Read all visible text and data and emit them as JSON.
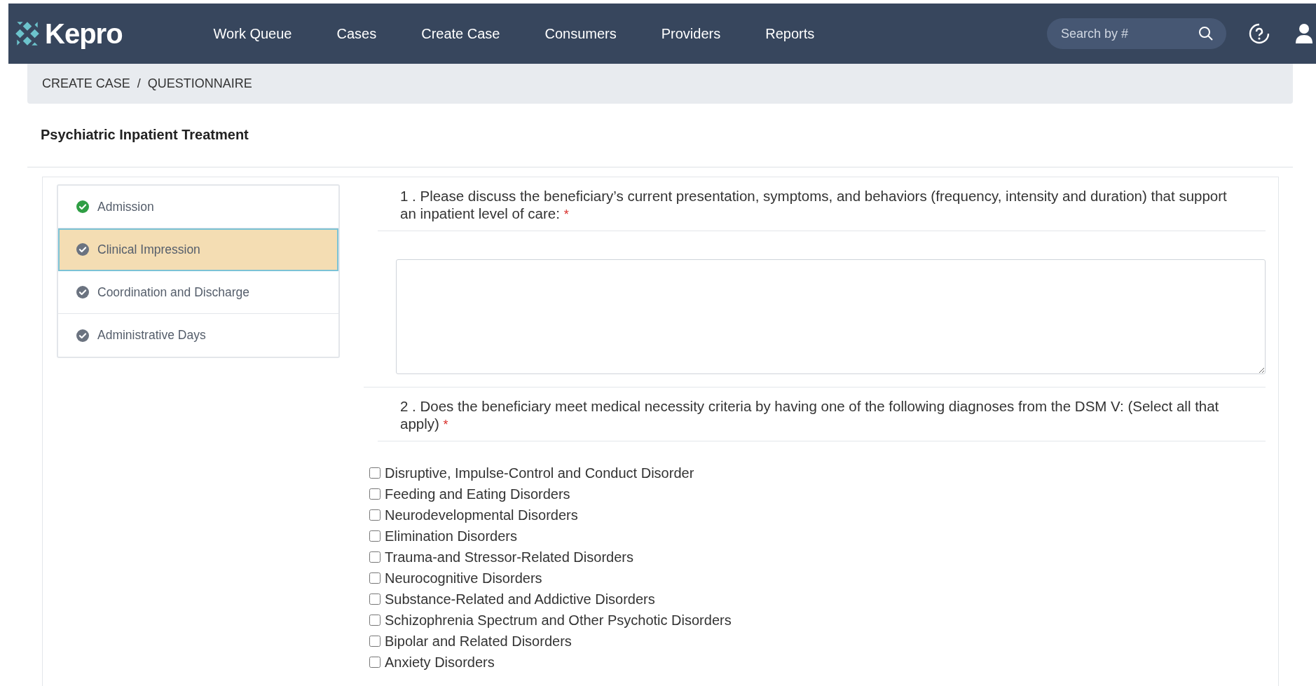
{
  "header": {
    "logo": "Kepro",
    "nav": [
      {
        "label": "Work Queue",
        "selected": false
      },
      {
        "label": "Cases",
        "selected": false
      },
      {
        "label": "Create Case",
        "selected": false
      },
      {
        "label": "Consumers",
        "selected": false
      },
      {
        "label": "Providers",
        "selected": false
      },
      {
        "label": "Reports",
        "selected": false
      }
    ],
    "search": {
      "placeholder": "Search by #"
    }
  },
  "breadcrumb": [
    "CREATE CASE",
    "QUESTIONNAIRE"
  ],
  "breadcrumb_separator": "/",
  "page_title": "Psychiatric Inpatient Treatment",
  "steps": [
    {
      "label": "Admission",
      "completed": true,
      "selected": false
    },
    {
      "label": "Clinical Impression",
      "completed": false,
      "selected": true
    },
    {
      "label": "Coordination and Discharge",
      "completed": false,
      "selected": false
    },
    {
      "label": "Administrative Days",
      "completed": false,
      "selected": false
    }
  ],
  "questions": [
    {
      "kind": "text",
      "number": "1 .",
      "text": "Please discuss the beneficiary’s current presentation, symptoms, and behaviors (frequency, intensity and duration) that support an inpatient level of care:",
      "required_mark": "*"
    },
    {
      "kind": "checklist",
      "number": "2 .",
      "text": "Does the beneficiary meet medical necessity criteria by having one of the following diagnoses from the DSM V: (Select all that apply)",
      "required_mark": "*",
      "options": [
        {
          "label": "Disruptive, Impulse-Control and Conduct Disorder",
          "checked": false
        },
        {
          "label": "Feeding and Eating Disorders",
          "checked": false
        },
        {
          "label": "Neurodevelopmental Disorders",
          "checked": false
        },
        {
          "label": "Elimination Disorders",
          "checked": false
        },
        {
          "label": "Trauma-and Stressor-Related Disorders",
          "checked": false
        },
        {
          "label": "Neurocognitive Disorders",
          "checked": false
        },
        {
          "label": "Substance-Related and Addictive Disorders",
          "checked": false
        },
        {
          "label": "Schizophrenia Spectrum and Other Psychotic Disorders",
          "checked": false
        },
        {
          "label": "Bipolar and Related Disorders",
          "checked": false
        },
        {
          "label": "Anxiety Disorders",
          "checked": false
        }
      ]
    }
  ]
}
